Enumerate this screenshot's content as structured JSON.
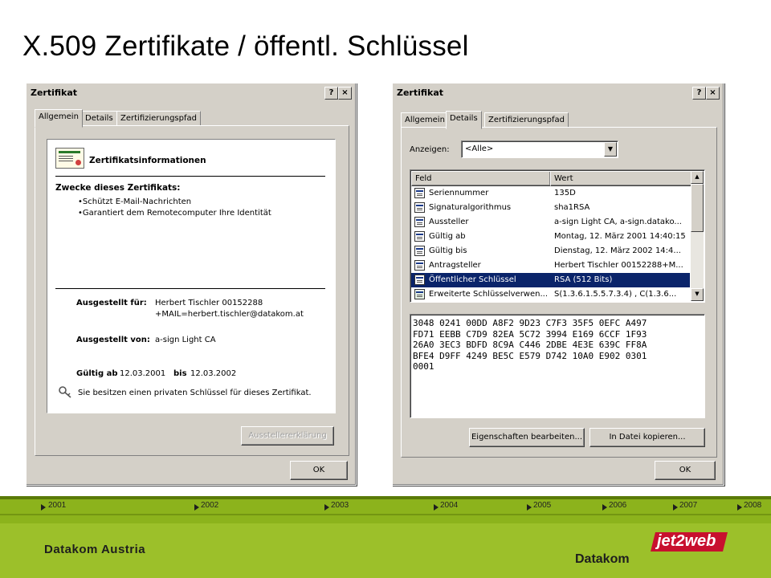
{
  "slide": {
    "title": "X.509 Zertifikate / öffentl. Schlüssel"
  },
  "dialog_left": {
    "title": "Zertifikat",
    "help": "?",
    "close": "×",
    "tabs": [
      "Allgemein",
      "Details",
      "Zertifizierungspfad"
    ],
    "heading": "Zertifikatsinformationen",
    "purposes_heading": "Zwecke dieses Zertifikats:",
    "purposes": [
      "•Schützt E-Mail-Nachrichten",
      "•Garantiert dem Remotecomputer Ihre Identität"
    ],
    "issued_to_label": "Ausgestellt für:",
    "issued_to_line1": "Herbert Tischler 00152288",
    "issued_to_line2": "+MAIL=herbert.tischler@datakom.at",
    "issued_by_label": "Ausgestellt von:",
    "issued_by_value": "a-sign Light CA",
    "valid_from_label": "Gültig ab",
    "valid_from": "12.03.2001",
    "valid_to_label": "bis",
    "valid_to": "12.03.2002",
    "private_key_note": "Sie besitzen einen privaten Schlüssel für dieses Zertifikat.",
    "issuer_statement_button": "Ausstellererklärung",
    "ok_button": "OK"
  },
  "dialog_right": {
    "title": "Zertifikat",
    "help": "?",
    "close": "×",
    "tabs": [
      "Allgemein",
      "Details",
      "Zertifizierungspfad"
    ],
    "show_label": "Anzeigen:",
    "show_value": "<Alle>",
    "col_field": "Feld",
    "col_value": "Wert",
    "rows": [
      {
        "field": "Seriennummer",
        "value": "135D"
      },
      {
        "field": "Signaturalgorithmus",
        "value": "sha1RSA"
      },
      {
        "field": "Aussteller",
        "value": "a-sign Light CA, a-sign.datako..."
      },
      {
        "field": "Gültig ab",
        "value": "Montag, 12. März 2001 14:40:15"
      },
      {
        "field": "Gültig bis",
        "value": "Dienstag, 12. März 2002 14:4..."
      },
      {
        "field": "Antragsteller",
        "value": "Herbert Tischler 00152288+M..."
      },
      {
        "field": "Öffentlicher Schlüssel",
        "value": "RSA (512 Bits)"
      },
      {
        "field": "Erweiterte Schlüsselverwen...",
        "value": "S(1.3.6.1.5.5.7.3.4) , C(1.3.6..."
      }
    ],
    "hex_lines": [
      "3048 0241 00DD A8F2 9D23 C7F3 35F5 0EFC A497",
      "FD71 EEBB C7D9 82EA 5C72 3994 E169 6CCF 1F93",
      "26A0 3EC3 BDFD 8C9A C446 2DBE 4E3E 639C FF8A",
      "BFE4 D9FF 4249 BE5C E579 D742 10A0 E902 0301",
      "0001"
    ],
    "edit_properties_button": "Eigenschaften bearbeiten...",
    "copy_to_file_button": "In Datei kopieren...",
    "ok_button": "OK"
  },
  "footer": {
    "years": [
      "2001",
      "2002",
      "2003",
      "2004",
      "2005",
      "2006",
      "2007",
      "2008"
    ],
    "company": "Datakom Austria",
    "logo_jet2web": "jet2web",
    "logo_datakom": "Datakom",
    "colors": {
      "band": "#8cb31c",
      "jet_red": "#c8102e"
    }
  }
}
